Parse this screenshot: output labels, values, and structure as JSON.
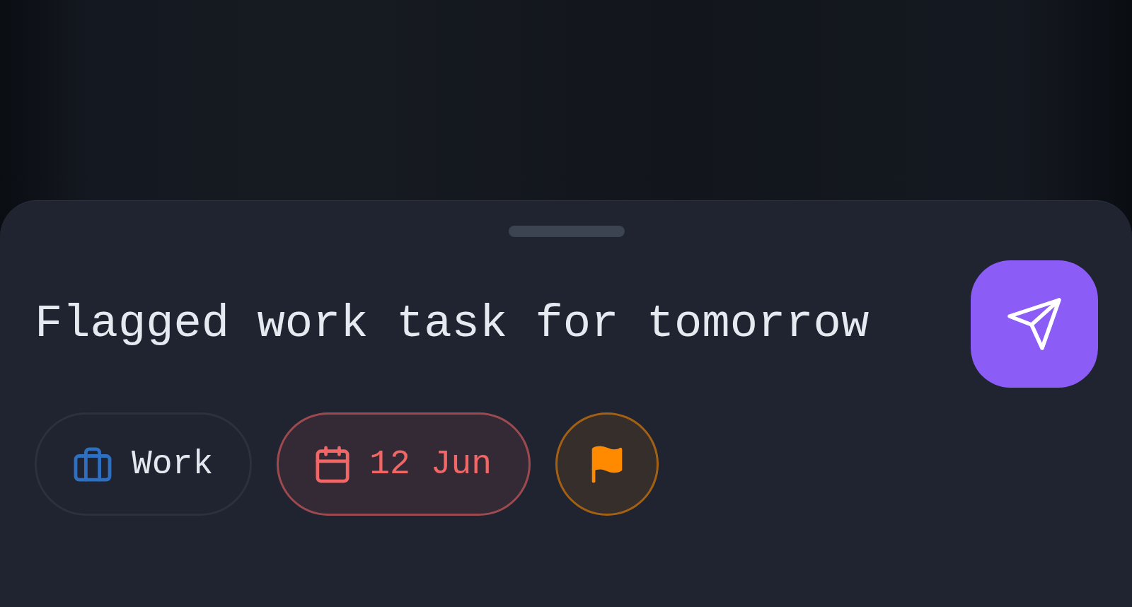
{
  "task_input": {
    "value": "Flagged work task for tomorrow"
  },
  "chips": [
    {
      "kind": "project",
      "label": "Work",
      "color": "#2f6fc0",
      "highlighted": false
    },
    {
      "kind": "date",
      "label": "12 Jun",
      "color": "#f26666",
      "highlighted": true
    },
    {
      "kind": "priority",
      "color": "#ff8a00",
      "highlighted": true
    }
  ]
}
